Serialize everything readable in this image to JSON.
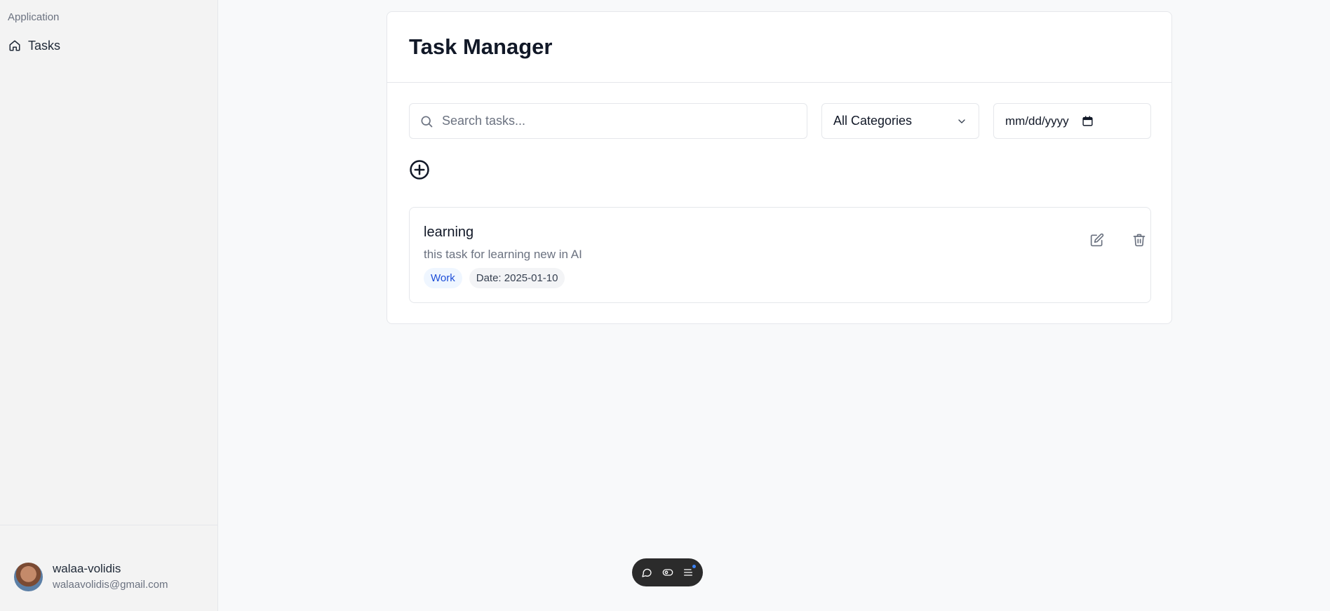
{
  "sidebar": {
    "group_label": "Application",
    "items": [
      {
        "label": "Tasks",
        "icon": "home-icon"
      }
    ],
    "user": {
      "name": "walaa-volidis",
      "email": "walaavolidis@gmail.com"
    }
  },
  "main": {
    "title": "Task Manager",
    "search": {
      "placeholder": "Search tasks...",
      "value": ""
    },
    "category_filter": {
      "selected": "All Categories"
    },
    "date_filter": {
      "placeholder": "mm/dd/yyyy"
    },
    "tasks": [
      {
        "title": "learning",
        "description": "this task for learning new in AI",
        "category": "Work",
        "date_label": "Date: 2025-01-10"
      }
    ]
  },
  "colors": {
    "accent": "#1d4ed8",
    "category_badge_bg": "#eff6ff",
    "toolbar_bg": "#2b2b2b"
  }
}
